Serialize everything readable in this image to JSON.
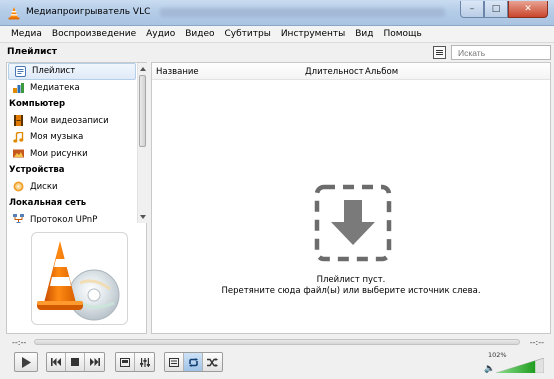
{
  "window": {
    "title": "Медиапроигрыватель VLC",
    "controls": {
      "minimize": "–",
      "maximize": "□",
      "close": "✕"
    }
  },
  "menu": [
    "Медиа",
    "Воспроизведение",
    "Аудио",
    "Видео",
    "Субтитры",
    "Инструменты",
    "Вид",
    "Помощь"
  ],
  "playlist_header": {
    "title": "Плейлист",
    "search_placeholder": "Искать"
  },
  "sidebar": {
    "items": [
      {
        "type": "item",
        "label": "Плейлист",
        "icon": "playlist-icon",
        "selected": true
      },
      {
        "type": "item",
        "label": "Медиатека",
        "icon": "library-icon"
      },
      {
        "type": "header",
        "label": "Компьютер"
      },
      {
        "type": "item",
        "label": "Мои видеозаписи",
        "icon": "film-icon"
      },
      {
        "type": "item",
        "label": "Моя музыка",
        "icon": "music-note-icon"
      },
      {
        "type": "item",
        "label": "Мои рисунки",
        "icon": "picture-icon"
      },
      {
        "type": "header",
        "label": "Устройства"
      },
      {
        "type": "item",
        "label": "Диски",
        "icon": "disc-icon"
      },
      {
        "type": "header",
        "label": "Локальная сеть"
      },
      {
        "type": "item",
        "label": "Протокол UPnP",
        "icon": "network-icon"
      }
    ]
  },
  "table": {
    "columns": [
      "Название",
      "Длительност",
      "Альбом"
    ],
    "empty_title": "Плейлист пуст.",
    "empty_hint": "Перетяните сюда файл(ы) или выберите источник слева."
  },
  "seek": {
    "elapsed": "--:--",
    "total": "--:--"
  },
  "volume": {
    "label": "102%",
    "level": 1.02
  },
  "colors": {
    "accent": "#ff8800",
    "volume_green": "#2fb52f",
    "selection": "#dfeaf8"
  }
}
